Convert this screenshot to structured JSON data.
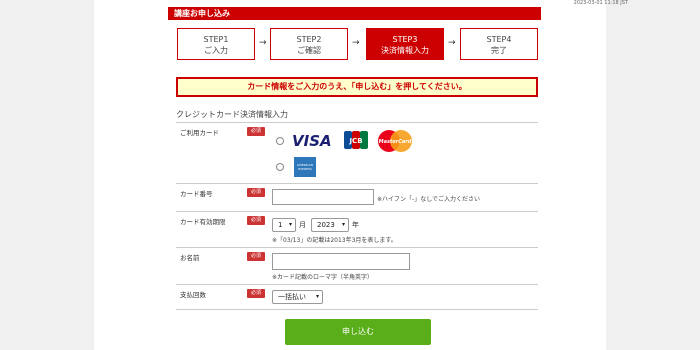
{
  "timestamp": "2023-03-01 11:18 JST",
  "title": "講座お申し込み",
  "steps": [
    {
      "label": "STEP1",
      "sub": "ご入力"
    },
    {
      "label": "STEP2",
      "sub": "ご確認"
    },
    {
      "label": "STEP3",
      "sub": "決済情報入力"
    },
    {
      "label": "STEP4",
      "sub": "完了"
    }
  ],
  "arrow": "→",
  "notice": "カード情報をご入力のうえ、「申し込む」を押してください。",
  "section_title": "クレジットカード決済情報入力",
  "required": "必須",
  "card_type": {
    "label": "ご利用カード"
  },
  "logos": {
    "visa": "VISA",
    "jcb": "JCB",
    "mastercard": "MasterCard",
    "amex": "AMERICAN EXPRESS"
  },
  "card_number": {
    "label": "カード番号",
    "value": "",
    "note": "※ハイフン「-」なしでご入力ください"
  },
  "expiry": {
    "label": "カード有効期限",
    "month": "1",
    "month_unit": "月",
    "year": "2023",
    "year_unit": "年",
    "note": "※「03/13」の記載は2013年3月を表します。"
  },
  "name": {
    "label": "お名前",
    "value": "",
    "note": "※カード記載のローマ字（半角英字）"
  },
  "installments": {
    "label": "支払回数",
    "value": "一括払い"
  },
  "submit_label": "申し込む",
  "colors": {
    "brand": "#cc0000",
    "submit": "#5aae1a",
    "notice_bg": "#ffffcc"
  }
}
